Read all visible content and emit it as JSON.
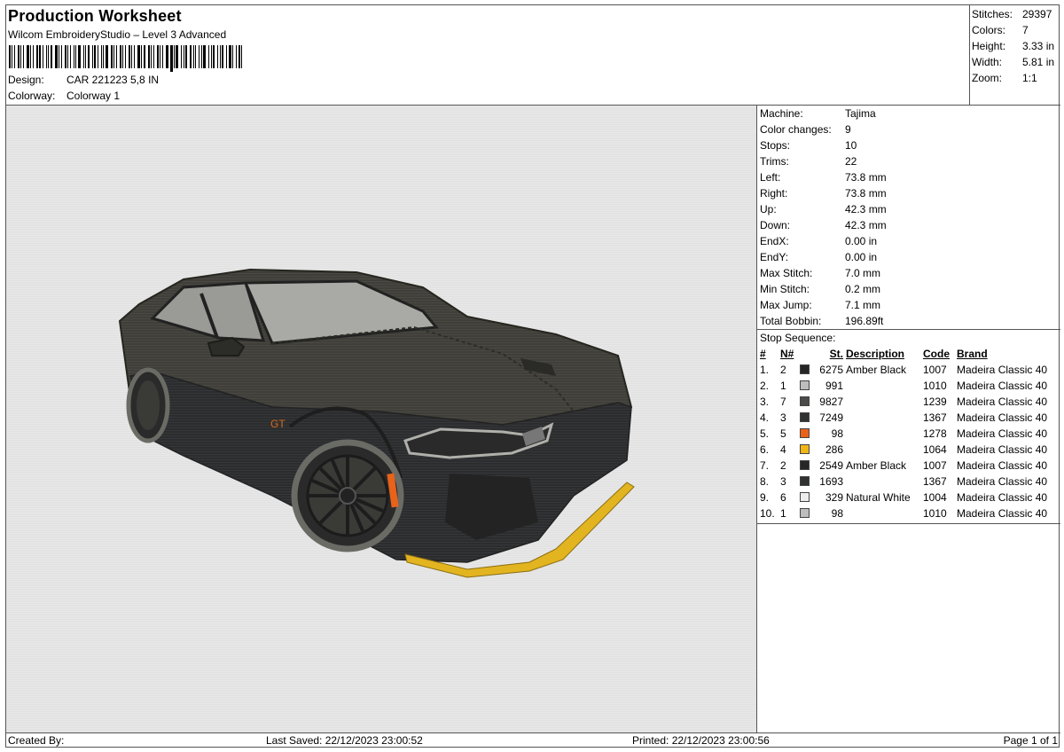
{
  "header": {
    "title": "Production Worksheet",
    "software": "Wilcom EmbroideryStudio – Level 3 Advanced",
    "design_label": "Design:",
    "design_value": "CAR 221223 5,8 IN",
    "colorway_label": "Colorway:",
    "colorway_value": "Colorway 1"
  },
  "summary": [
    {
      "label": "Stitches:",
      "value": "29397"
    },
    {
      "label": "Colors:",
      "value": "7"
    },
    {
      "label": "Height:",
      "value": "3.33 in"
    },
    {
      "label": "Width:",
      "value": "5.81 in"
    },
    {
      "label": "Zoom:",
      "value": "1:1"
    }
  ],
  "machine": [
    {
      "label": "Machine:",
      "value": "Tajima"
    },
    {
      "label": "Color changes:",
      "value": "9"
    },
    {
      "label": "Stops:",
      "value": "10"
    },
    {
      "label": "Trims:",
      "value": "22"
    },
    {
      "label": "Left:",
      "value": "73.8 mm"
    },
    {
      "label": "Right:",
      "value": "73.8 mm"
    },
    {
      "label": "Up:",
      "value": "42.3 mm"
    },
    {
      "label": "Down:",
      "value": "42.3 mm"
    },
    {
      "label": "EndX:",
      "value": "0.00 in"
    },
    {
      "label": "EndY:",
      "value": "0.00 in"
    },
    {
      "label": "Max Stitch:",
      "value": "7.0 mm"
    },
    {
      "label": "Min Stitch:",
      "value": "0.2 mm"
    },
    {
      "label": "Max Jump:",
      "value": "7.1 mm"
    },
    {
      "label": "Total Bobbin:",
      "value": "196.89ft"
    }
  ],
  "stop_sequence": {
    "title": "Stop Sequence:",
    "headers": {
      "num": "#",
      "n": "N#",
      "st": "St.",
      "desc": "Description",
      "code": "Code",
      "brand": "Brand"
    },
    "rows": [
      {
        "num": "1.",
        "n": "2",
        "color": "#262626",
        "st": "6275",
        "desc": "Amber Black",
        "code": "1007",
        "brand": "Madeira Classic 40"
      },
      {
        "num": "2.",
        "n": "1",
        "color": "#bdbdbd",
        "st": "991",
        "desc": "",
        "code": "1010",
        "brand": "Madeira Classic 40"
      },
      {
        "num": "3.",
        "n": "7",
        "color": "#4b4b49",
        "st": "9827",
        "desc": "",
        "code": "1239",
        "brand": "Madeira Classic 40"
      },
      {
        "num": "4.",
        "n": "3",
        "color": "#2f3133",
        "st": "7249",
        "desc": "",
        "code": "1367",
        "brand": "Madeira Classic 40"
      },
      {
        "num": "5.",
        "n": "5",
        "color": "#e8621a",
        "st": "98",
        "desc": "",
        "code": "1278",
        "brand": "Madeira Classic 40"
      },
      {
        "num": "6.",
        "n": "4",
        "color": "#f2b518",
        "st": "286",
        "desc": "",
        "code": "1064",
        "brand": "Madeira Classic 40"
      },
      {
        "num": "7.",
        "n": "2",
        "color": "#262626",
        "st": "2549",
        "desc": "Amber Black",
        "code": "1007",
        "brand": "Madeira Classic 40"
      },
      {
        "num": "8.",
        "n": "3",
        "color": "#2f3133",
        "st": "1693",
        "desc": "",
        "code": "1367",
        "brand": "Madeira Classic 40"
      },
      {
        "num": "9.",
        "n": "6",
        "color": "#ececec",
        "st": "329",
        "desc": "Natural White",
        "code": "1004",
        "brand": "Madeira Classic 40"
      },
      {
        "num": "10.",
        "n": "1",
        "color": "#bdbdbd",
        "st": "98",
        "desc": "",
        "code": "1010",
        "brand": "Madeira Classic 40"
      }
    ]
  },
  "footer": {
    "created_by": "Created By:",
    "last_saved": "Last Saved: 22/12/2023 23:00:52",
    "printed": "Printed: 22/12/2023 23:00:56",
    "page": "Page 1 of 1"
  }
}
